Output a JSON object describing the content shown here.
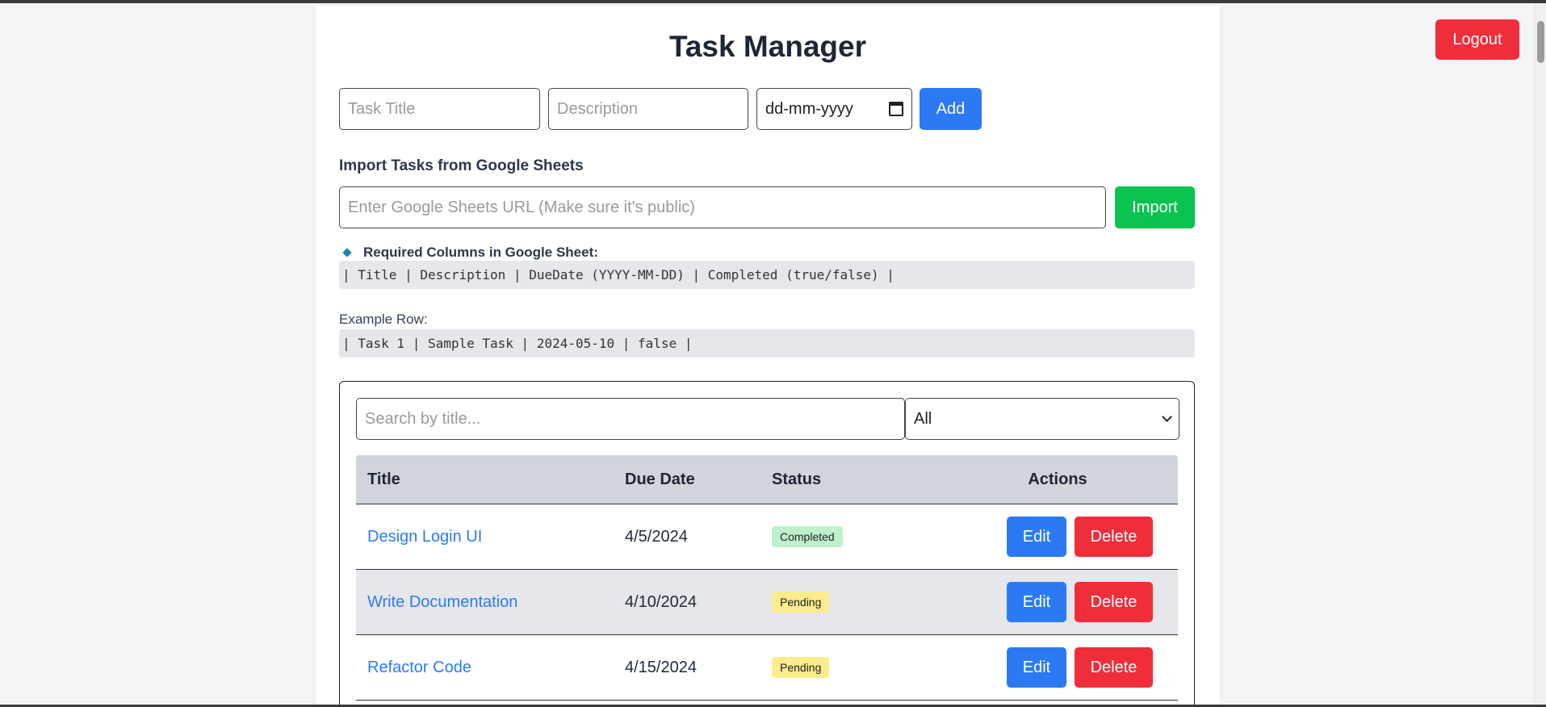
{
  "header": {
    "logout_label": "Logout"
  },
  "page": {
    "title": "Task Manager"
  },
  "add_form": {
    "title_placeholder": "Task Title",
    "description_placeholder": "Description",
    "date_placeholder": "dd-mm-yyyy",
    "add_label": "Add"
  },
  "import": {
    "heading": "Import Tasks from Google Sheets",
    "url_placeholder": "Enter Google Sheets URL (Make sure it's public)",
    "import_label": "Import",
    "required_label": "Required Columns in Google Sheet:",
    "required_columns": "| Title | Description | DueDate (YYYY-MM-DD) | Completed (true/false) |",
    "example_label": "Example Row:",
    "example_row": "| Task 1 | Sample Task | 2024-05-10 | false |"
  },
  "filters": {
    "search_placeholder": "Search by title...",
    "status_selected": "All"
  },
  "table": {
    "headers": {
      "title": "Title",
      "due_date": "Due Date",
      "status": "Status",
      "actions": "Actions"
    },
    "rows": [
      {
        "title": "Design Login UI",
        "due_date": "4/5/2024",
        "status": "Completed"
      },
      {
        "title": "Write Documentation",
        "due_date": "4/10/2024",
        "status": "Pending"
      },
      {
        "title": "Refactor Code",
        "due_date": "4/15/2024",
        "status": "Pending"
      }
    ],
    "edit_label": "Edit",
    "delete_label": "Delete"
  },
  "colors": {
    "primary": "#2b7af3",
    "success": "#09c44f",
    "danger": "#ef2d3b",
    "completed_badge": "#bff0cd",
    "pending_badge": "#fcec8c"
  }
}
